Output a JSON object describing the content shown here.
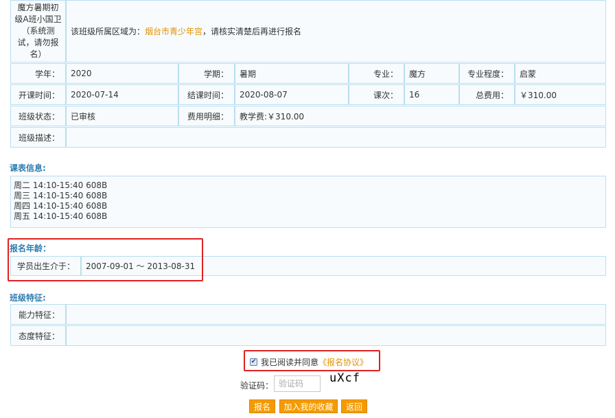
{
  "class": {
    "name": "魔方暑期初级A班小国卫（系统测试，请勿报名）",
    "area_notice_prefix": "该班级所属区域为：",
    "area_name": "烟台市青少年宫",
    "area_notice_suffix": "，请核实清楚后再进行报名"
  },
  "info": {
    "year_label": "学年：",
    "year": "2020",
    "term_label": "学期：",
    "term": "暑期",
    "major_label": "专业：",
    "major": "魔方",
    "level_label": "专业程度：",
    "level": "启蒙",
    "start_label": "开课时间：",
    "start": "2020-07-14",
    "end_label": "结课时间：",
    "end": "2020-08-07",
    "lessons_label": "课次：",
    "lessons": "16",
    "total_fee_label": "总费用：",
    "total_fee": "￥310.00",
    "status_label": "班级状态：",
    "status": "已审核",
    "fee_detail_label": "费用明细：",
    "fee_detail": "教学费:￥310.00",
    "desc_label": "班级描述：",
    "desc": ""
  },
  "schedule": {
    "title": "课表信息:",
    "lines": [
      "周二 14:10-15:40 608B",
      "周三 14:10-15:40 608B",
      "周四 14:10-15:40 608B",
      "周五 14:10-15:40 608B"
    ]
  },
  "age": {
    "title": "报名年龄：",
    "birth_label": "学员出生介于：",
    "birth_range": "2007-09-01 ～ 2013-08-31"
  },
  "features": {
    "title": "班级特征:",
    "ability_label": "能力特征：",
    "ability": "",
    "attitude_label": "态度特征：",
    "attitude": ""
  },
  "agreement": {
    "checked": true,
    "text": "我已阅读并同意",
    "link": "《报名协议》"
  },
  "captcha": {
    "label": "验证码：",
    "placeholder": "验证码",
    "code": "uXcf"
  },
  "buttons": {
    "enroll": "报名",
    "favorite": "加入我的收藏",
    "back": "返回"
  },
  "colors": {
    "accent": "#f39b00",
    "highlight": "#e39200",
    "section_title": "#2d7cb0",
    "border": "#b9def0",
    "annotation": "#e02020"
  }
}
